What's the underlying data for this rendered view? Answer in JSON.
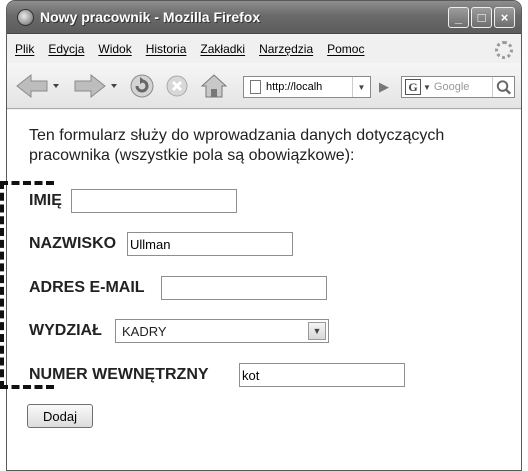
{
  "window": {
    "title": "Nowy pracownik - Mozilla Firefox",
    "controls": {
      "minimize": "_",
      "maximize": "□",
      "close": "×"
    }
  },
  "menu": {
    "items": [
      "Plik",
      "Edycja",
      "Widok",
      "Historia",
      "Zakładki",
      "Narzędzia",
      "Pomoc"
    ]
  },
  "toolbar": {
    "url": "http://localh",
    "search_placeholder": "Google",
    "search_engine_glyph": "G",
    "icons": [
      "back-icon",
      "forward-icon",
      "reload-icon",
      "stop-icon",
      "home-icon",
      "page-icon",
      "go-icon",
      "search-icon"
    ]
  },
  "page": {
    "intro": "Ten formularz służy do wprowadzania danych dotyczących pracownika (wszystkie pola są obowiązkowe):",
    "fields": {
      "first_name": {
        "label": "IMIĘ",
        "value": ""
      },
      "last_name": {
        "label": "NAZWISKO",
        "value": "Ullman"
      },
      "email": {
        "label": "ADRES E-MAIL",
        "value": ""
      },
      "department": {
        "label": "WYDZIAŁ",
        "value": "KADRY"
      },
      "extension": {
        "label": "NUMER WEWNĘTRZNY",
        "value": "kot"
      }
    },
    "submit_label": "Dodaj"
  },
  "colors": {
    "titlebar": "#6a6a6a",
    "content_background": "#ffffff",
    "text": "#222222"
  }
}
